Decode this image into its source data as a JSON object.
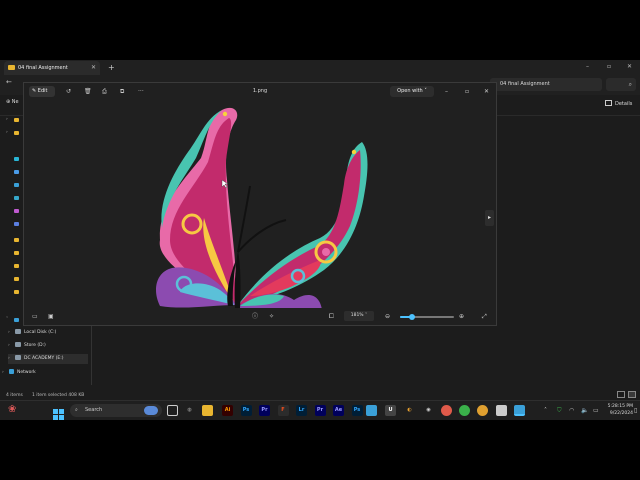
{
  "explorer": {
    "tab_title": "04 final Assignment",
    "address_path": "04 final Assignment",
    "new_label": "Ne",
    "details_label": "Details",
    "drives": [
      {
        "label": "Local Disk (C:)"
      },
      {
        "label": "Store (D:)"
      },
      {
        "label": "DC ACADEMY (E:)"
      }
    ],
    "network_label": "Network",
    "status_count": "4 items",
    "status_selected": "1 item selected  408 KB"
  },
  "photos": {
    "edit_label": "Edit",
    "filename": "1.png",
    "open_with_label": "Open with",
    "zoom_value": "181%",
    "zoom_fraction": 0.23
  },
  "taskbar": {
    "search_label": "Search",
    "time": "5:28:15 PM",
    "date": "9/22/2024",
    "apps": [
      {
        "name": "ai-app-icon",
        "glyph": "Ai",
        "bg": "#330000",
        "fg": "#ff9a00"
      },
      {
        "name": "photoshop-icon",
        "glyph": "Ps",
        "bg": "#001e36",
        "fg": "#31a8ff"
      },
      {
        "name": "premiere-pro-icon",
        "glyph": "Pr",
        "bg": "#00005b",
        "fg": "#9999ff"
      },
      {
        "name": "figma-icon",
        "glyph": "F",
        "bg": "#2c2c2c",
        "fg": "#f24e1e"
      },
      {
        "name": "lightroom-icon",
        "glyph": "Lr",
        "bg": "#001e36",
        "fg": "#31a8ff"
      },
      {
        "name": "premiere-pro-2-icon",
        "glyph": "Pr",
        "bg": "#00005b",
        "fg": "#9999ff"
      },
      {
        "name": "after-effects-icon",
        "glyph": "Ae",
        "bg": "#00005b",
        "fg": "#9999ff"
      },
      {
        "name": "photoshop-2-icon",
        "glyph": "Ps",
        "bg": "#001e36",
        "fg": "#31a8ff"
      }
    ]
  }
}
